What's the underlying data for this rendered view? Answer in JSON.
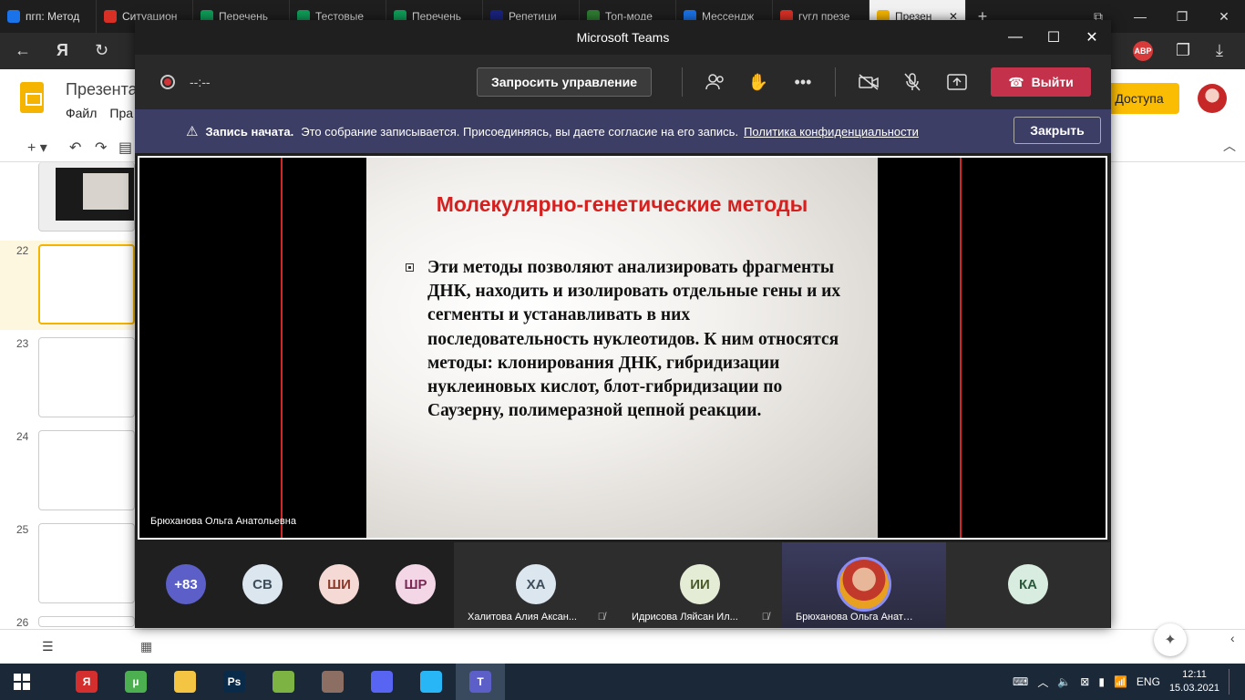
{
  "browser": {
    "tabs": [
      {
        "label": "пгп: Метод",
        "color": "#1a73e8"
      },
      {
        "label": "Ситуацион",
        "color": "#d93025"
      },
      {
        "label": "Перечень",
        "color": "#0f9d58"
      },
      {
        "label": "Тестовые",
        "color": "#0f9d58"
      },
      {
        "label": "Перечень",
        "color": "#0f9d58"
      },
      {
        "label": "Репетици",
        "color": "#1a237e"
      },
      {
        "label": "Топ-моде",
        "color": "#2e7d32"
      },
      {
        "label": "Мессендж",
        "color": "#1a73e8"
      },
      {
        "label": "гугл презе",
        "color": "#d93025"
      },
      {
        "label": "Презен",
        "color": "#f4b400"
      }
    ],
    "abp_label": "ABP"
  },
  "slides": {
    "doc_title": "Презента",
    "menu": [
      "Файл",
      "Пра"
    ],
    "share_label": "Доступа",
    "thumb_numbers": [
      "22",
      "23",
      "24",
      "25",
      "26"
    ]
  },
  "teams": {
    "window_title": "Microsoft Teams",
    "record_time": "--:--",
    "request_control": "Запросить управление",
    "leave": "Выйти",
    "banner": {
      "bold": "Запись начата.",
      "text": "Это собрание записывается. Присоединяясь, вы даете согласие на его запись.",
      "link": "Политика конфиденциальности",
      "close": "Закрыть"
    },
    "presenter_name": "Брюханова Ольга Анатольевна",
    "slide": {
      "title": "Молекулярно-генетические методы",
      "body": "Эти методы позволяют анализировать фрагменты ДНК, находить и изолировать отдельные гены и их сегменты и устанавливать в них последовательность нуклеотидов. К ним относятся методы: клонирования ДНК, гибридизации нуклеиновых кислот, блот-гибридизации по Саузерну, полимеразной цепной реакции."
    },
    "gallery": {
      "overflow": "+83",
      "bubbles": [
        {
          "initials": "СВ",
          "bg": "#dce6ee",
          "fg": "#3e4e5c"
        },
        {
          "initials": "ШИ",
          "bg": "#f5d9d4",
          "fg": "#8a3a2a"
        },
        {
          "initials": "ШР",
          "bg": "#f3d7e6",
          "fg": "#7a2a55"
        }
      ],
      "tiles": [
        {
          "initials": "ХА",
          "name": "Халитова Алия Аксан...",
          "bg": "#dce6ee",
          "fg": "#3e4e5c",
          "muted": true
        },
        {
          "initials": "ИИ",
          "name": "Идрисова Ляйсан Ил...",
          "bg": "#e4ecd6",
          "fg": "#4a5a2a",
          "muted": true
        },
        {
          "initials": "",
          "name": "Брюханова Ольга Анатол...",
          "photo": true
        },
        {
          "initials": "КА",
          "name": "",
          "bg": "#d8ece0",
          "fg": "#2a5a3c"
        }
      ]
    }
  },
  "taskbar": {
    "apps": [
      {
        "name": "yandex",
        "label": "Я",
        "color": "#d32f2f"
      },
      {
        "name": "utorrent",
        "label": "µ",
        "color": "#4caf50"
      },
      {
        "name": "explorer",
        "label": "",
        "color": "#f4c542"
      },
      {
        "name": "photoshop",
        "label": "Ps",
        "color": "#0a2a4a"
      },
      {
        "name": "maps",
        "label": "",
        "color": "#7cb342"
      },
      {
        "name": "pencil",
        "label": "",
        "color": "#8d6e63"
      },
      {
        "name": "discord",
        "label": "",
        "color": "#5865f2"
      },
      {
        "name": "network",
        "label": "",
        "color": "#29b6f6"
      },
      {
        "name": "teams",
        "label": "T",
        "color": "#5b5fc7"
      }
    ],
    "lang": "ENG",
    "time": "12:11",
    "date": "15.03.2021"
  }
}
